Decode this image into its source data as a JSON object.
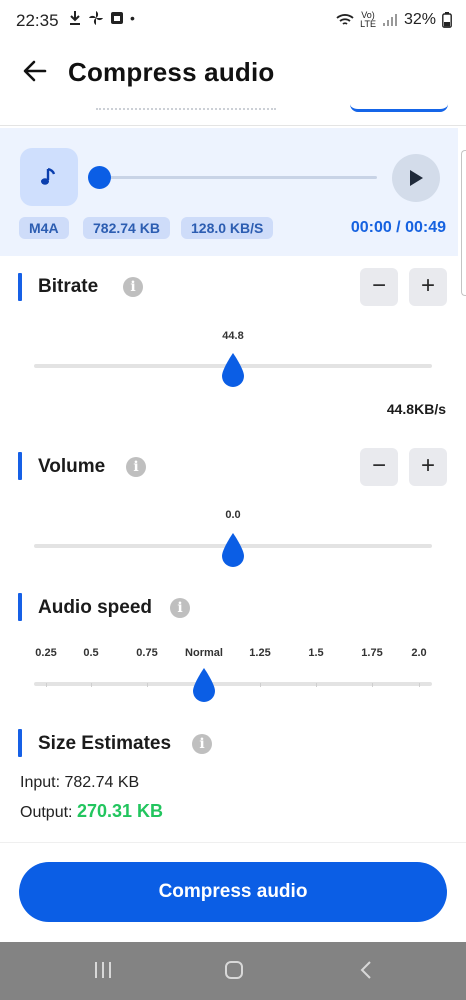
{
  "status_bar": {
    "time": "22:35",
    "dot": "•",
    "net_top": "Vo)",
    "net_bottom": "LTE",
    "battery": "32%",
    "icons": [
      "download-icon",
      "pinwheel-icon",
      "sim-card-icon",
      "wifi-icon",
      "signal-icon",
      "battery-icon"
    ]
  },
  "header": {
    "title": "Compress audio",
    "back_icon": "arrow-left-icon"
  },
  "player": {
    "format": "M4A",
    "file_size": "782.74 KB",
    "bitrate_chip": "128.0 KB/S",
    "time": "00:00 / 00:49",
    "progress": 0,
    "icons": [
      "music-note-icon",
      "play-icon"
    ]
  },
  "bitrate": {
    "title": "Bitrate",
    "thumb_label": "44.8",
    "value_text": "44.8KB/s",
    "level": 0.5,
    "minus": "−",
    "plus": "+",
    "info": "i"
  },
  "volume": {
    "title": "Volume",
    "thumb_label": "0.0",
    "level": 0.5,
    "minus": "−",
    "plus": "+",
    "info": "i"
  },
  "audio_speed": {
    "title": "Audio speed",
    "info": "i",
    "labels": [
      "0.25",
      "0.5",
      "0.75",
      "Normal",
      "1.25",
      "1.5",
      "1.75",
      "2.0"
    ],
    "selected": "Normal"
  },
  "size_estimates": {
    "title": "Size Estimates",
    "info": "i",
    "input_label": "Input:",
    "input_value": "782.74 KB",
    "output_label": "Output:",
    "output_value": "270.31 KB"
  },
  "actions": {
    "compress_label": "Compress audio"
  },
  "nav_bar": {
    "icons": [
      "recent-apps-icon",
      "home-icon",
      "back-nav-icon"
    ]
  },
  "colors": {
    "accent": "#0b5ee5",
    "output_green": "#22c55e",
    "panel_bg": "#edf3fe"
  }
}
